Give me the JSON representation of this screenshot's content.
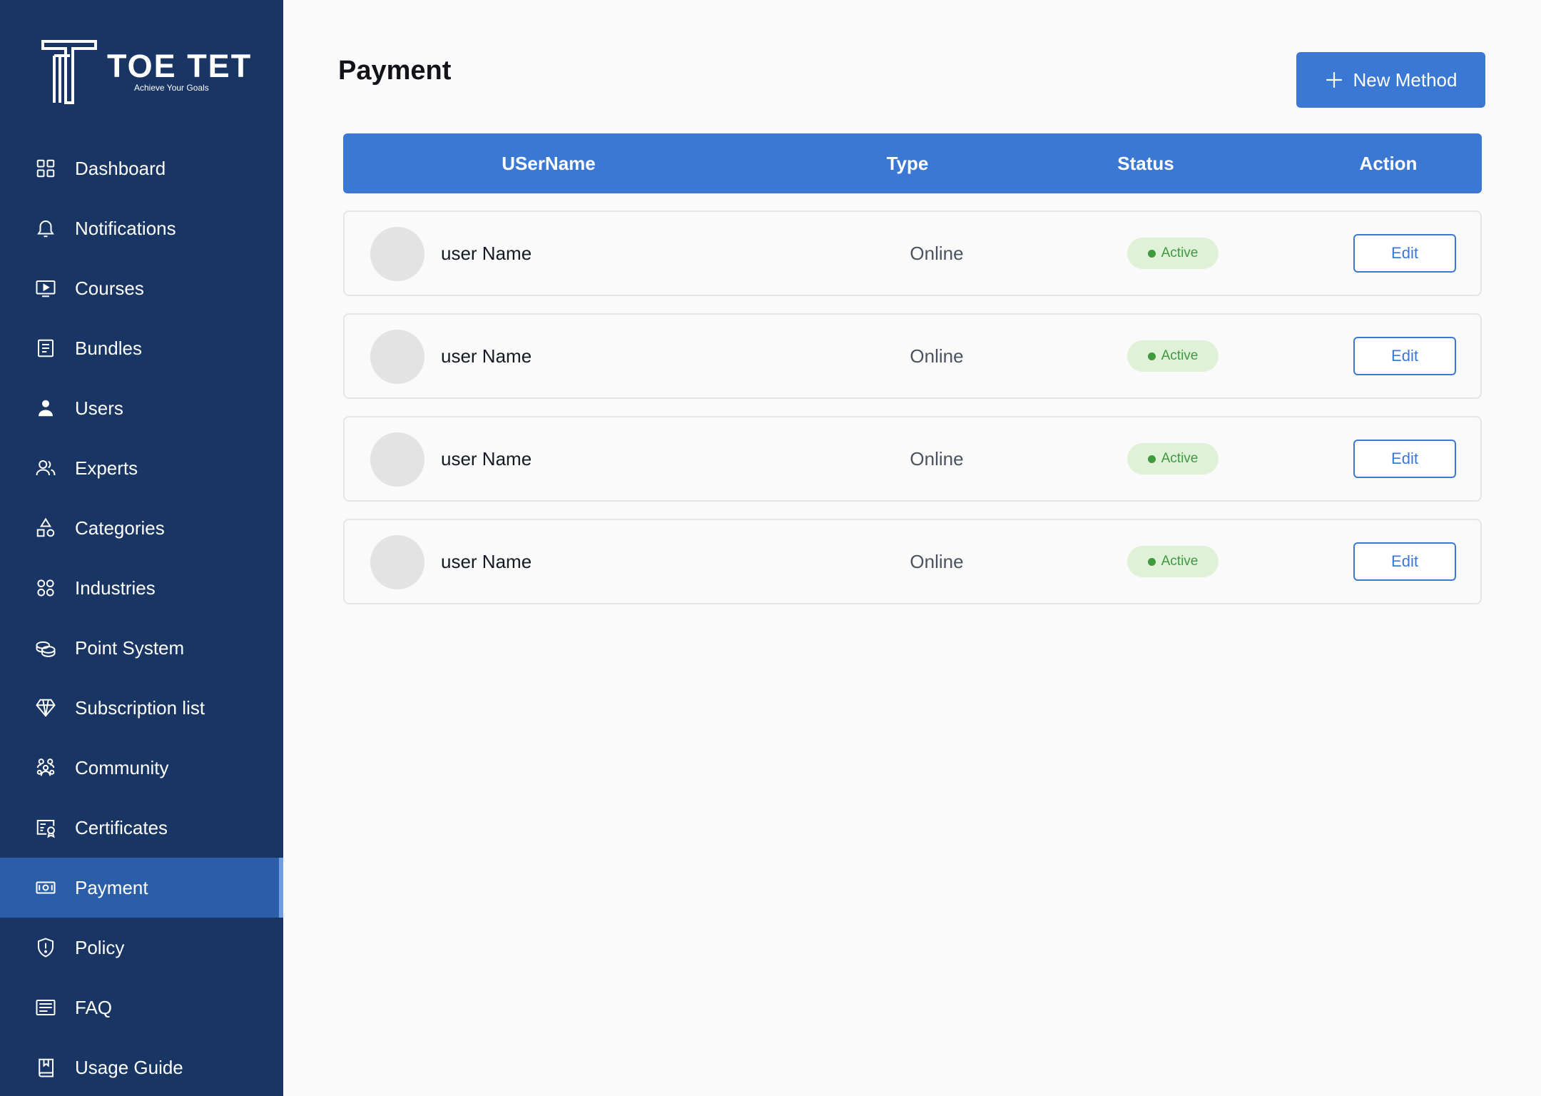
{
  "brand": {
    "name": "TOE TET",
    "tagline": "Achieve Your Goals"
  },
  "sidebar": {
    "items": [
      {
        "label": "Dashboard",
        "icon": "dashboard-grid-icon",
        "active": false
      },
      {
        "label": "Notifications",
        "icon": "bell-icon",
        "active": false
      },
      {
        "label": "Courses",
        "icon": "play-screen-icon",
        "active": false
      },
      {
        "label": "Bundles",
        "icon": "document-list-icon",
        "active": false
      },
      {
        "label": "Users",
        "icon": "user-icon",
        "active": false
      },
      {
        "label": "Experts",
        "icon": "users-outline-icon",
        "active": false
      },
      {
        "label": "Categories",
        "icon": "shapes-icon",
        "active": false
      },
      {
        "label": "Industries",
        "icon": "four-circles-icon",
        "active": false
      },
      {
        "label": "Point System",
        "icon": "coins-icon",
        "active": false
      },
      {
        "label": "Subscription list",
        "icon": "diamond-icon",
        "active": false
      },
      {
        "label": "Community",
        "icon": "community-icon",
        "active": false
      },
      {
        "label": "Certificates",
        "icon": "certificate-icon",
        "active": false
      },
      {
        "label": "Payment",
        "icon": "money-icon",
        "active": true
      },
      {
        "label": "Policy",
        "icon": "shield-icon",
        "active": false
      },
      {
        "label": "FAQ",
        "icon": "faq-list-icon",
        "active": false
      },
      {
        "label": "Usage Guide",
        "icon": "book-bookmark-icon",
        "active": false
      }
    ]
  },
  "main": {
    "title": "Payment",
    "new_button_label": "New Method",
    "columns": {
      "username": "USerName",
      "type": "Type",
      "status": "Status",
      "action": "Action"
    },
    "rows": [
      {
        "name": "user Name",
        "type": "Online",
        "status": "Active",
        "action": "Edit"
      },
      {
        "name": "user Name",
        "type": "Online",
        "status": "Active",
        "action": "Edit"
      },
      {
        "name": "user Name",
        "type": "Online",
        "status": "Active",
        "action": "Edit"
      },
      {
        "name": "user Name",
        "type": "Online",
        "status": "Active",
        "action": "Edit"
      }
    ]
  },
  "colors": {
    "sidebar_bg": "#183563",
    "sidebar_active": "#2a5ea8",
    "accent": "#3b78d4",
    "badge_bg": "#dff1d6",
    "badge_text": "#3e9a3e",
    "page_bg": "#fafafa"
  }
}
